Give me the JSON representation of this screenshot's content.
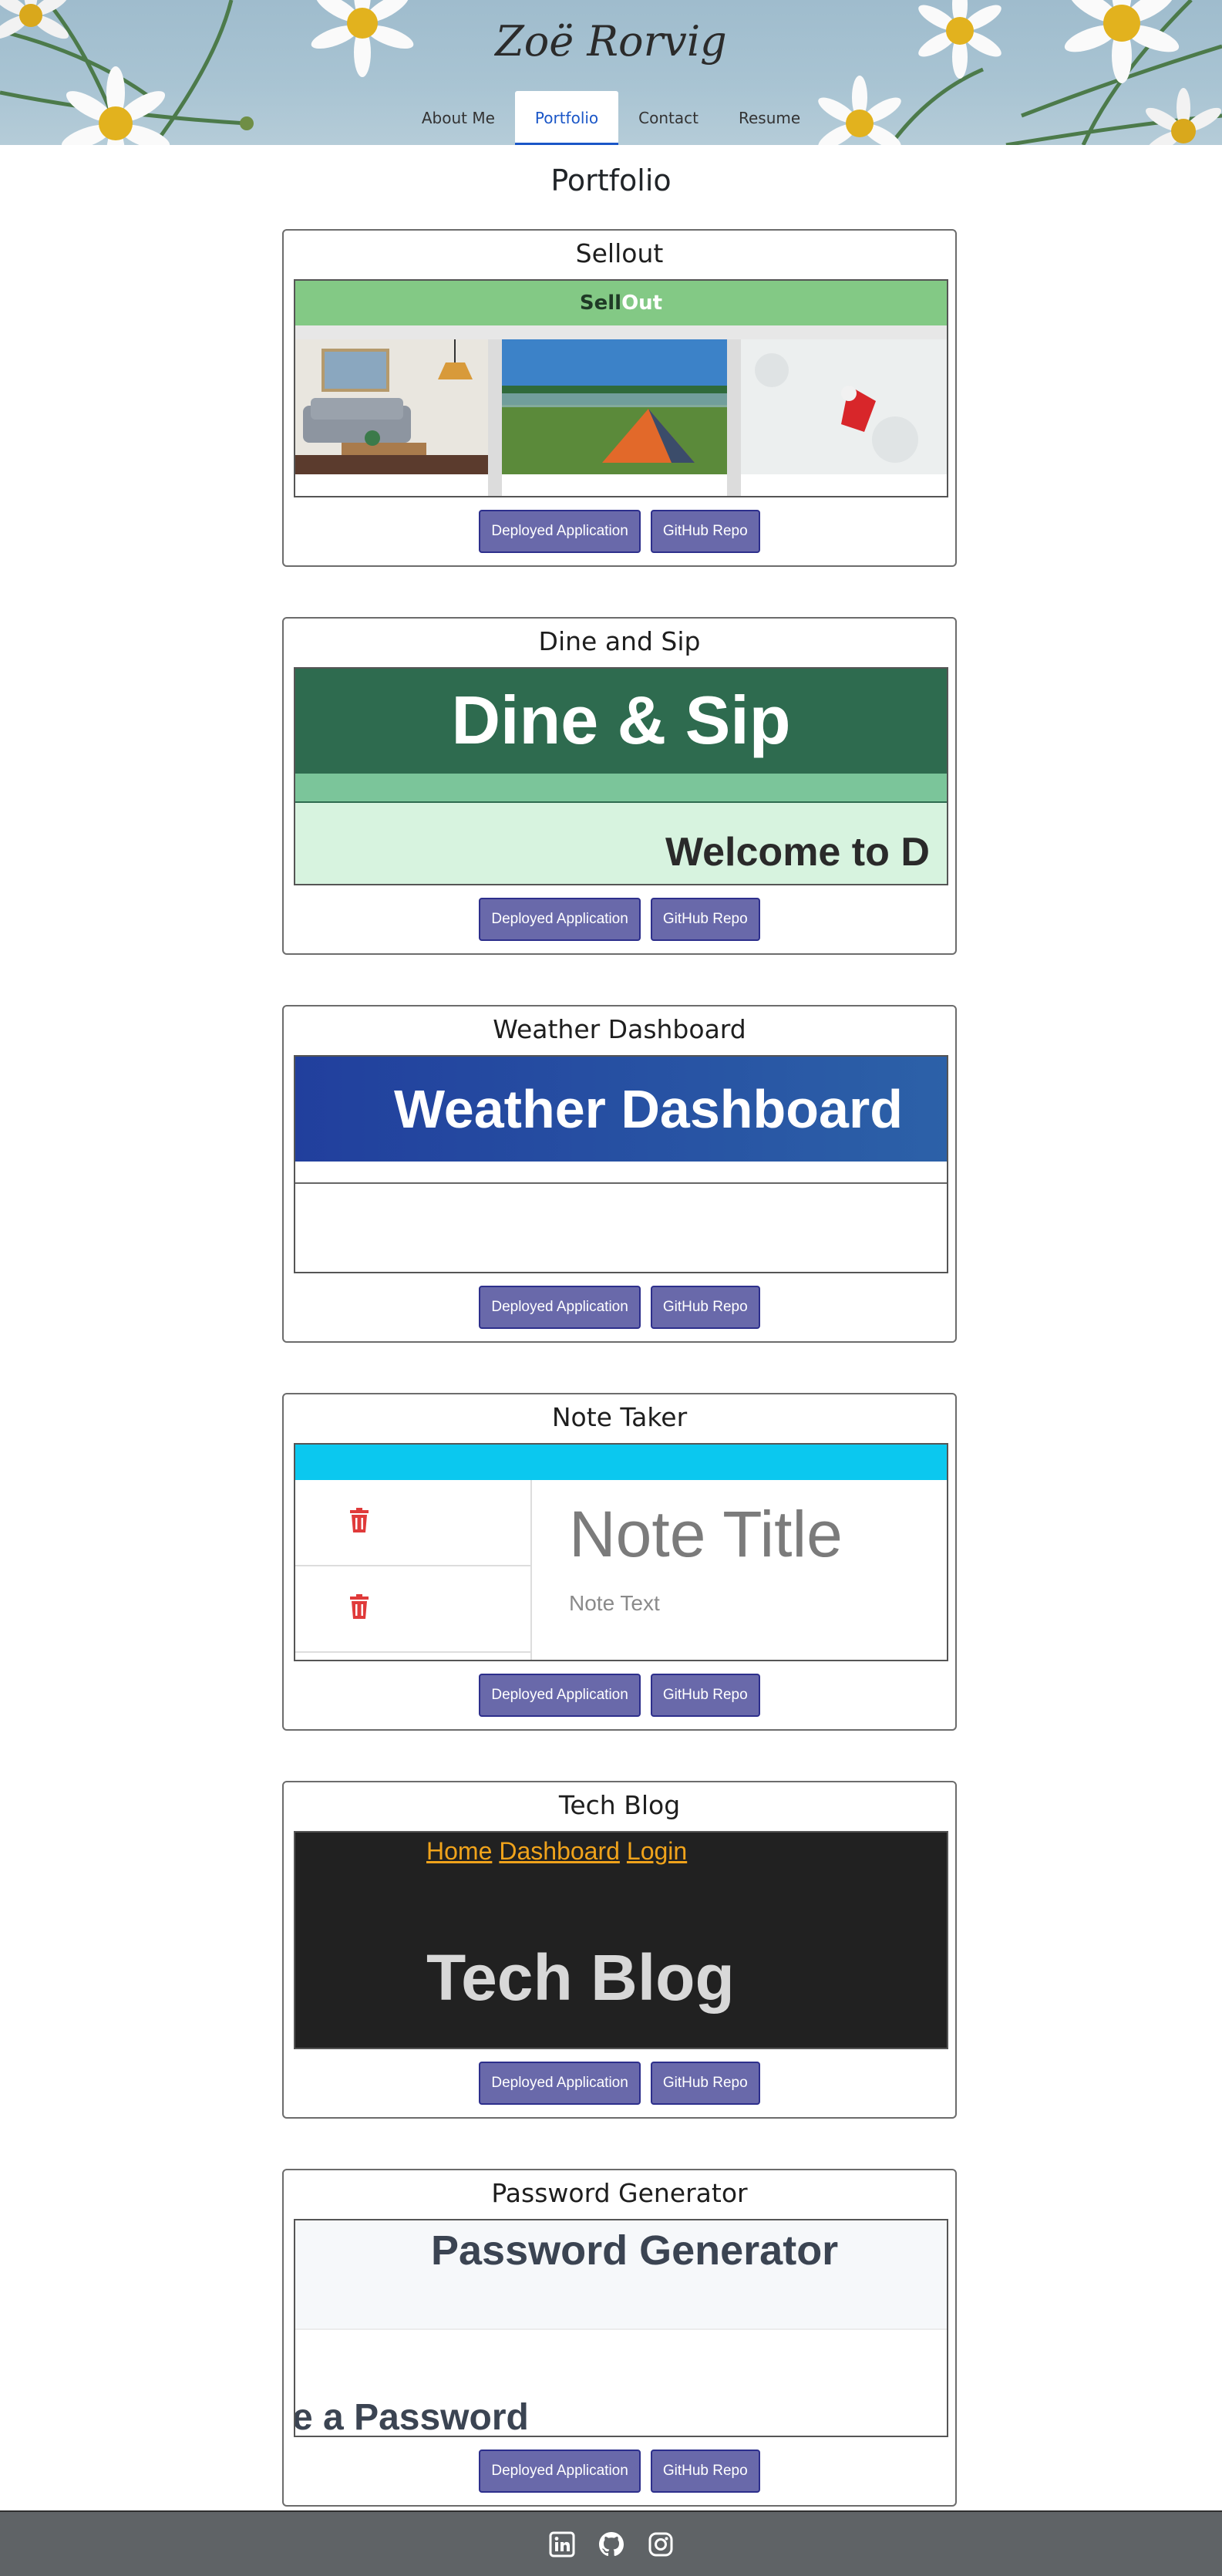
{
  "site": {
    "title": "Zoë Rorvig"
  },
  "nav": {
    "items": [
      {
        "label": "About Me",
        "active": false
      },
      {
        "label": "Portfolio",
        "active": true
      },
      {
        "label": "Contact",
        "active": false
      },
      {
        "label": "Resume",
        "active": false
      }
    ]
  },
  "page": {
    "title": "Portfolio"
  },
  "buttons": {
    "deployed": "Deployed Application",
    "github": "GitHub Repo"
  },
  "projects": [
    {
      "title": "Sellout",
      "preview": {
        "logo_sell": "Sell",
        "logo_out": "Out"
      }
    },
    {
      "title": "Dine and Sip",
      "preview": {
        "heading": "Dine & Sip",
        "welcome": "Welcome to D"
      }
    },
    {
      "title": "Weather Dashboard",
      "preview": {
        "heading": "Weather Dashboard"
      }
    },
    {
      "title": "Note Taker",
      "preview": {
        "note_title": "Note Title",
        "note_text": "Note Text"
      }
    },
    {
      "title": "Tech Blog",
      "preview": {
        "nav_home": "Home",
        "nav_dashboard": "Dashboard",
        "nav_login": "Login",
        "heading": "Tech Blog"
      }
    },
    {
      "title": "Password Generator",
      "preview": {
        "heading": "Password Generator",
        "subheading": "e a Password"
      }
    }
  ],
  "footer": {
    "icons": [
      "linkedin-icon",
      "github-icon",
      "instagram-icon"
    ]
  },
  "colors": {
    "accent": "#1a56c7",
    "button_bg": "#6969aa",
    "button_border": "#2d2f8c",
    "footer_bg": "#5f6366"
  }
}
